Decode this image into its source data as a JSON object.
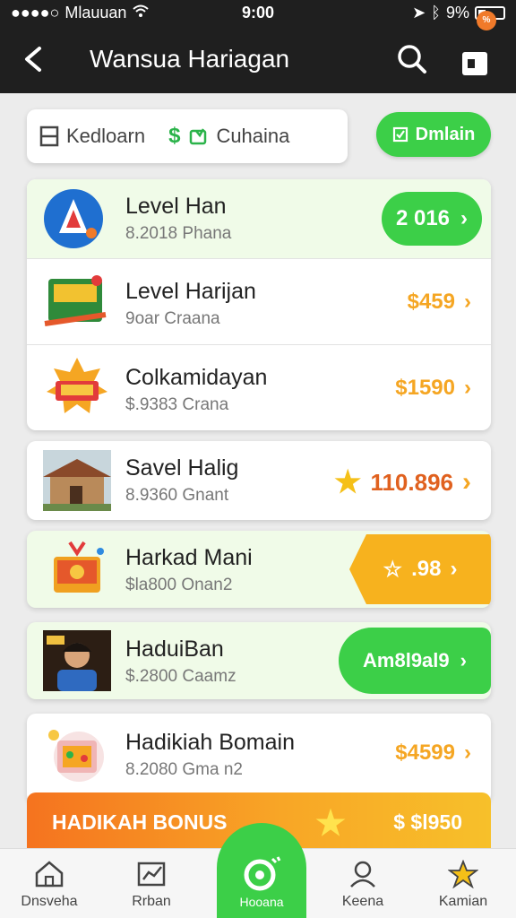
{
  "status_bar": {
    "carrier": "Mlauuan",
    "time": "9:00",
    "battery": "9%"
  },
  "header": {
    "title": "Wansua Hariagan",
    "badge": "%"
  },
  "filter": {
    "left_label": "Kedloarn",
    "right_label": "Cuhaina",
    "button_label": "Dmlain"
  },
  "items": [
    {
      "name": "Level Han",
      "sub": "8.2018 Phana",
      "price": "2 016"
    },
    {
      "name": "Level Harijan",
      "sub": "9oar Craana",
      "price": "$459"
    },
    {
      "name": "Colkamidayan",
      "sub": "$.9383 Crana",
      "price": "$1590"
    },
    {
      "name": "Savel Halig",
      "sub": "8.9360 Gnant",
      "price": "110.896"
    },
    {
      "name": "Harkad Mani",
      "sub": "$la800 Onan2",
      "price": ".98"
    },
    {
      "name": "HaduiBan",
      "sub": "$.2800 Caamz",
      "price": "Am8l9al9"
    },
    {
      "name": "Hadikiah Bomain",
      "sub": "8.2080 Gma n2",
      "price": "$4599"
    }
  ],
  "bonus": {
    "title": "HADIKAH BONUS",
    "price": "$ $l950"
  },
  "tabs": [
    "Dnsveha",
    "Rrban",
    "Hooana",
    "Keena",
    "Kamian"
  ],
  "colors": {
    "green": "#3ccf48",
    "orange": "#f5a623",
    "dark": "#1f1f1f"
  }
}
